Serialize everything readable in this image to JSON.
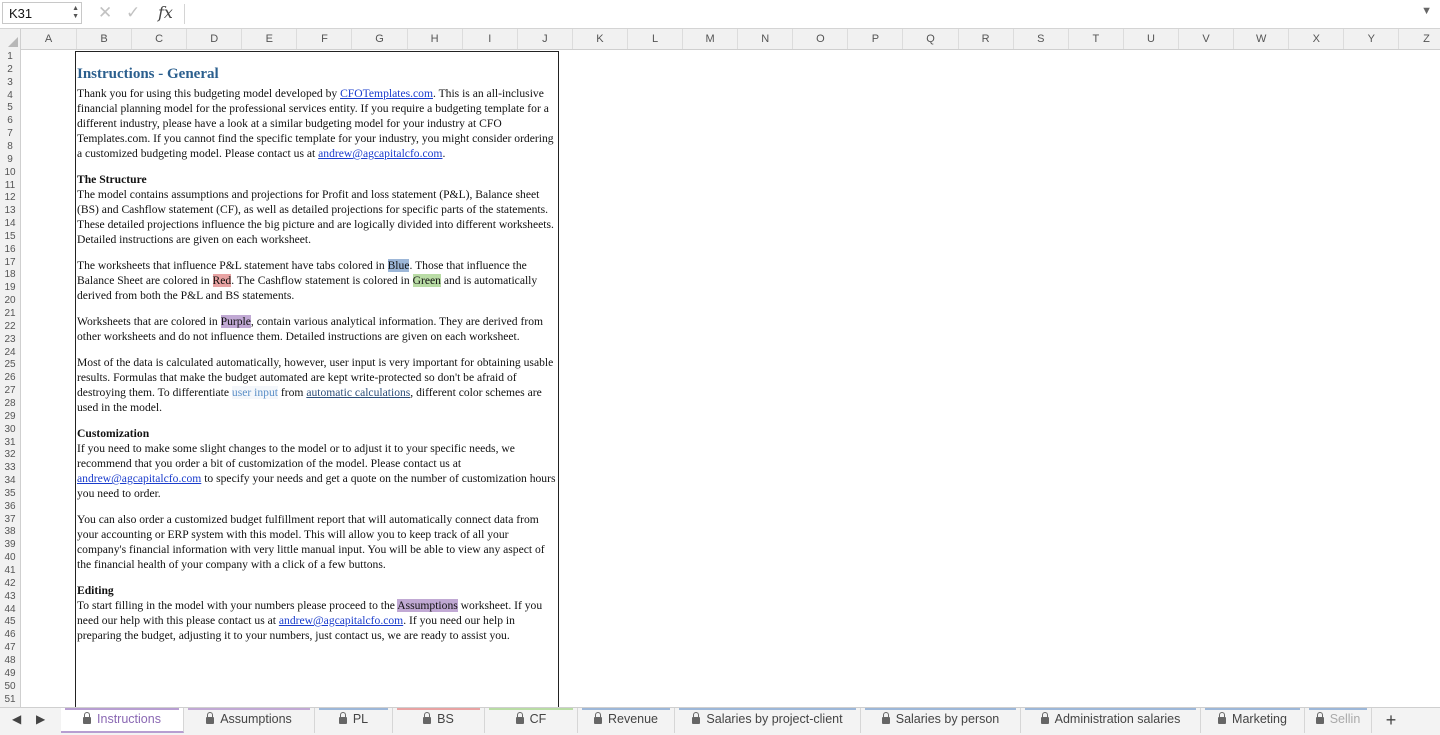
{
  "formula_bar": {
    "name_box": "K31",
    "cancel_icon": "✕",
    "enter_icon": "✓",
    "fx_label": "fx",
    "formula": ""
  },
  "columns": [
    "A",
    "B",
    "C",
    "D",
    "E",
    "F",
    "G",
    "H",
    "I",
    "J",
    "K",
    "L",
    "M",
    "N",
    "O",
    "P",
    "Q",
    "R",
    "S",
    "T",
    "U",
    "V",
    "W",
    "X",
    "Y",
    "Z"
  ],
  "rows": [
    "1",
    "2",
    "3",
    "4",
    "5",
    "6",
    "7",
    "8",
    "9",
    "10",
    "11",
    "12",
    "13",
    "14",
    "15",
    "16",
    "17",
    "18",
    "19",
    "20",
    "21",
    "22",
    "23",
    "24",
    "25",
    "26",
    "27",
    "28",
    "29",
    "30",
    "31",
    "32",
    "33",
    "34",
    "35",
    "36",
    "37",
    "38",
    "39",
    "40",
    "41",
    "42",
    "43",
    "44",
    "45",
    "46",
    "47",
    "48",
    "49",
    "50",
    "51"
  ],
  "textbox": {
    "title": "Instructions - General",
    "intro": {
      "part1": "Thank you for using this budgeting model developed by ",
      "link1": "CFOTemplates.com",
      "part2": ". This is an all-inclusive financial planning model for the professional services entity. If you require a budgeting template for a different industry, please have a look at a similar budgeting model for your industry at CFO Templates.com. If you cannot find the specific template for your industry, you might consider ordering a customized budgeting model. Please contact us at ",
      "email": "andrew@agcapitalcfo.com",
      "part3": "."
    },
    "structure_heading": "The Structure",
    "structure_p1": "The model contains assumptions and projections for Profit and loss statement (P&L), Balance sheet (BS) and Cashflow statement (CF), as well as detailed projections for specific parts of the statements. These detailed projections influence the big picture and are logically divided into different worksheets. Detailed instructions are given on each worksheet.",
    "structure_p2": {
      "part1": "The worksheets that influence P&L statement have tabs colored in ",
      "blue": "Blue",
      "part2": ". Those that influence the  Balance Sheet are colored in ",
      "red": "Red",
      "part3": ". The Cashflow statement is colored in ",
      "green": "Green",
      "part4": " and is automatically derived from both the P&L and BS statements."
    },
    "structure_p3": {
      "part1": "Worksheets that are colored in ",
      "purple": "Purple",
      "part2": ", contain various analytical information. They are derived from other worksheets and do not influence them. Detailed instructions are given on each worksheet."
    },
    "structure_p4": {
      "part1": "Most of the data is calculated automatically, however, user input is very important for obtaining usable results. Formulas that make the budget automated are kept write-protected so don't be afraid of destroying them. To differentiate ",
      "user_input": "user input",
      "part2": " from ",
      "auto_calc": "automatic calculations",
      "part3": ", different color schemes are used in the model."
    },
    "customization_heading": "Customization",
    "customization_p1": {
      "part1": "If you need to make some slight changes to the model or to adjust it to your specific needs, we recommend that you order a bit of customization of the model. Please contact us at ",
      "email": "andrew@agcapitalcfo.com",
      "part2": " to specify your needs and get a quote on the number of customization hours you need to order."
    },
    "customization_p2": "You can also order a customized budget fulfillment report that will automatically connect data from your accounting or ERP system with this model. This will allow you to keep track of all your company's financial information with very little manual input. You will be able to view any aspect of the financial health of your company with a click of a few buttons.",
    "editing_heading": "Editing",
    "editing_p1": {
      "part1": "To start filling in the model with your numbers please proceed to the ",
      "assumptions": "Assumptions",
      "part2": " worksheet. If you need our help with this please contact us at ",
      "email": "andrew@agcapitalcfo.com",
      "part3": ". If you need our help in preparing the budget, adjusting it to your numbers, just contact us, we are ready to assist you."
    }
  },
  "tabs": [
    {
      "label": "Instructions",
      "color": "#b79ed1"
    },
    {
      "label": "Assumptions",
      "color": "#c1a9d4"
    },
    {
      "label": "PL",
      "color": "#9db7d8"
    },
    {
      "label": "BS",
      "color": "#e8a3a3"
    },
    {
      "label": "CF",
      "color": "#b9dca5"
    },
    {
      "label": "Revenue",
      "color": "#9db7d8"
    },
    {
      "label": "Salaries by project-client",
      "color": "#9db7d8"
    },
    {
      "label": "Salaries by person",
      "color": "#9db7d8"
    },
    {
      "label": "Administration salaries",
      "color": "#9db7d8"
    },
    {
      "label": "Marketing",
      "color": "#9db7d8"
    },
    {
      "label": "Sellin",
      "color": "#9db7d8"
    }
  ],
  "tab_nav": {
    "prev": "◀",
    "next": "▶",
    "add": "+"
  }
}
